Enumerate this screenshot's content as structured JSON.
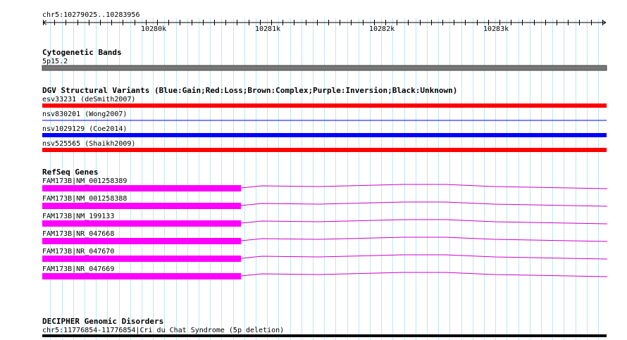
{
  "view": {
    "coords": "chr5:10279025..10283956",
    "ticks": [
      "10280k",
      "10281k",
      "10282k",
      "10283k"
    ]
  },
  "colors": {
    "grid": "#bfe6f2",
    "gain": "#0000ff",
    "loss": "#ff0000",
    "gene": "#ff00ff",
    "band": "#777777",
    "disorder": "#000000"
  },
  "tracks": {
    "cytoband": {
      "title": "Cytogenetic Bands",
      "features": [
        {
          "label": "5p15.2"
        }
      ]
    },
    "dgv": {
      "title": "DGV Structural Variants (Blue:Gain;Red:Loss;Brown:Complex;Purple:Inversion;Black:Unknown)",
      "features": [
        {
          "label": "esv33231 (deSmith2007)",
          "type": "loss"
        },
        {
          "label": "nsv830201 (Wong2007)",
          "type": "gain"
        },
        {
          "label": "nsv1029129 (Coe2014)",
          "type": "gain"
        },
        {
          "label": "nsv525565 (Shaikh2009)",
          "type": "loss"
        }
      ]
    },
    "refseq": {
      "title": "RefSeq Genes",
      "features": [
        {
          "label": "FAM173B|NM_001258389"
        },
        {
          "label": "FAM173B|NM_001258388"
        },
        {
          "label": "FAM173B|NM_199133"
        },
        {
          "label": "FAM173B|NR_047668"
        },
        {
          "label": "FAM173B|NR_047670"
        },
        {
          "label": "FAM173B|NR_047669"
        }
      ]
    },
    "decipher": {
      "title": "DECIPHER Genomic Disorders",
      "features": [
        {
          "label": "chr5:11776854-11776854|Cri du Chat Syndrome (5p deletion)"
        }
      ]
    }
  }
}
